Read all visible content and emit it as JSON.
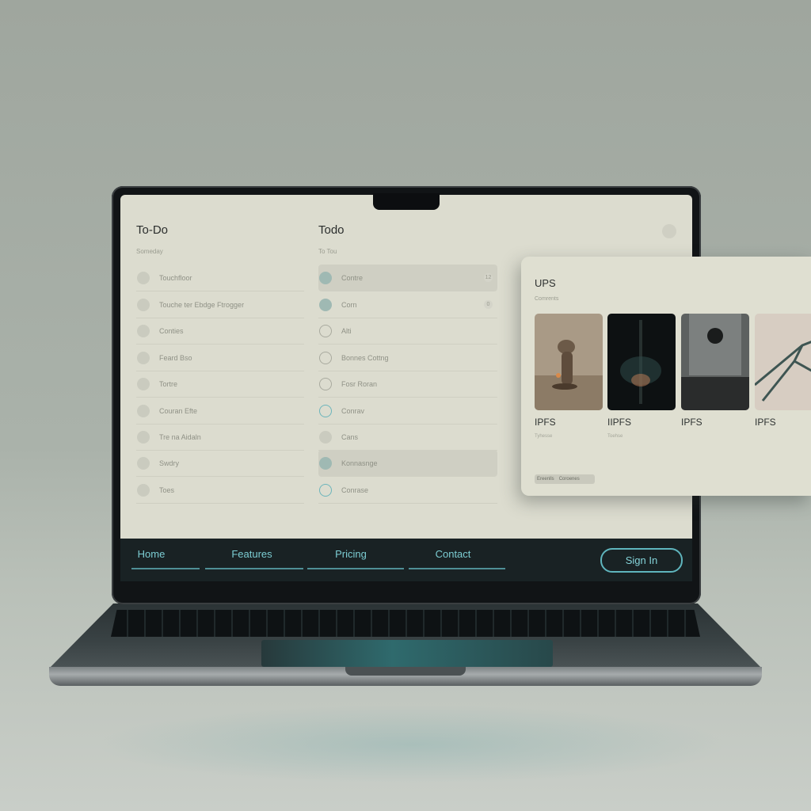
{
  "screen": {
    "left_column": {
      "title": "To-Do",
      "subtitle": "Someday",
      "items": [
        {
          "label": "Touchfloor",
          "state": "filled-gray"
        },
        {
          "label": "Touche ter Ebdge Ftrogger",
          "state": "filled-gray"
        },
        {
          "label": "Conties",
          "state": "filled-gray"
        },
        {
          "label": "Feard Bso",
          "state": "filled-gray"
        },
        {
          "label": "Tortre",
          "state": "filled-gray"
        },
        {
          "label": "Couran Efte",
          "state": "filled-gray"
        },
        {
          "label": "Tre na Aidaln",
          "state": "filled-gray"
        },
        {
          "label": "Swdry",
          "state": "filled-gray"
        },
        {
          "label": "Toes",
          "state": "filled-gray"
        }
      ]
    },
    "right_column": {
      "title": "Todo",
      "subtitle": "To Tou",
      "items": [
        {
          "label": "Contre",
          "state": "filled-teal",
          "highlight": true,
          "badge": "12"
        },
        {
          "label": "Corn",
          "state": "filled-teal",
          "highlight": false,
          "badge": "0"
        },
        {
          "label": "Alti",
          "state": "ring-gray",
          "highlight": false
        },
        {
          "label": "Bonnes Cottng",
          "state": "ring-gray",
          "highlight": false
        },
        {
          "label": "Fosr Roran",
          "state": "ring-gray",
          "highlight": false
        },
        {
          "label": "Conrav",
          "state": "ring-teal",
          "highlight": false
        },
        {
          "label": "Cans",
          "state": "filled-gray",
          "highlight": false
        },
        {
          "label": "Konnasnge",
          "state": "filled-teal",
          "highlight": true
        },
        {
          "label": "Conrase",
          "state": "ring-teal",
          "highlight": false
        }
      ]
    },
    "nav": {
      "items": [
        "Home",
        "Features",
        "Pricing",
        "Contact"
      ],
      "signin_label": "Sign In"
    }
  },
  "panel": {
    "title": "UPS",
    "subtitle": "Comrents",
    "cards": [
      {
        "label": "IPFS",
        "sublabel": "Tyhesse"
      },
      {
        "label": "IIPFS",
        "sublabel": "Toehse"
      },
      {
        "label": "IPFS",
        "sublabel": ""
      },
      {
        "label": "IPFS",
        "sublabel": ""
      }
    ],
    "chips": [
      "Ereenlls",
      "Coroenes"
    ]
  },
  "colors": {
    "accent": "#7ccdd3",
    "nav_bg": "#192224",
    "screen_bg": "#dcdccf"
  }
}
